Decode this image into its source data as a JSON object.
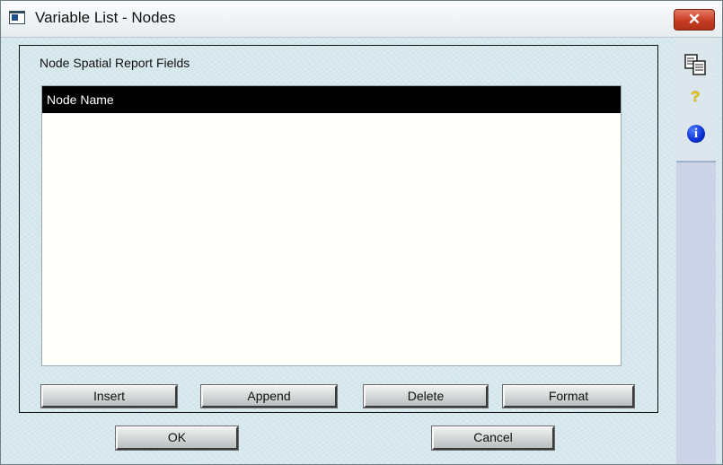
{
  "window": {
    "title": "Variable List - Nodes",
    "close_glyph": "✕"
  },
  "group": {
    "label": "Node Spatial Report Fields"
  },
  "list": {
    "items": [
      "Node Name"
    ],
    "selected_index": 0
  },
  "buttons": {
    "insert": "Insert",
    "append": "Append",
    "delete": "Delete",
    "format": "Format",
    "ok": "OK",
    "cancel": "Cancel"
  },
  "sidebar": {
    "icons": [
      "copy-pages-icon",
      "help-icon",
      "info-icon"
    ],
    "help_glyph": "?",
    "info_glyph": "i"
  },
  "colors": {
    "background": "#d6e8ed",
    "selection": "#000000",
    "close_button": "#c63c22",
    "info_icon": "#0a2fd1",
    "help_icon": "#e8c200"
  }
}
